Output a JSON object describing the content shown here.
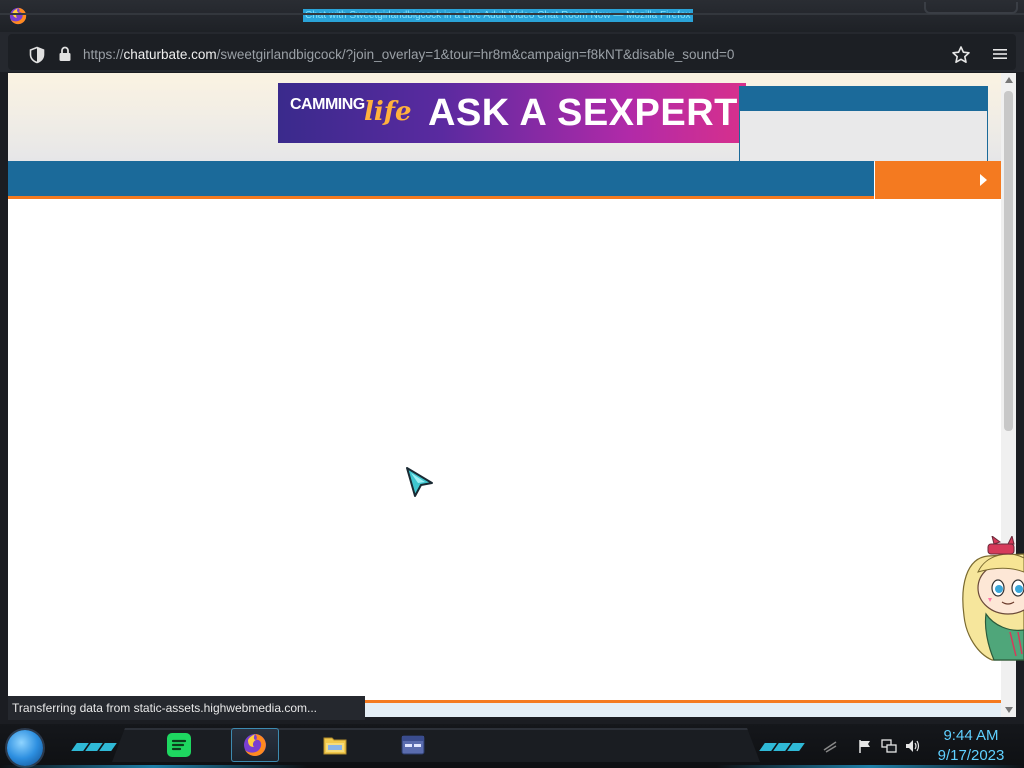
{
  "window": {
    "title": "Chat with Sweetgirlandbigcock in a Live Adult Video Chat Room Now — Mozilla Firefox"
  },
  "navbar": {
    "url_prefix": "https://",
    "url_domain": "chaturbate.com",
    "url_path": "/sweetgirlandbigcock/?join_overlay=1&tour=hr8m&campaign=f8kNT&disable_sound=0",
    "icons": [
      "shield-icon",
      "lock-icon",
      "bookmark-star-icon",
      "menu-icon"
    ]
  },
  "page": {
    "ad": {
      "brand_part1": "CAMMING",
      "brand_part2": "life",
      "headline": "ASK A SEXPERT"
    }
  },
  "status": {
    "text": "Transferring data from static-assets.highwebmedia.com..."
  },
  "taskbar": {
    "apps": [
      {
        "name": "Spotify",
        "active": false
      },
      {
        "name": "Firefox",
        "active": true
      },
      {
        "name": "File Explorer",
        "active": false
      },
      {
        "name": "Window",
        "active": false
      }
    ],
    "clock": {
      "time": "9:44 AM",
      "date": "9/17/2023"
    }
  },
  "colors": {
    "accent_blue": "#1b6a9a",
    "accent_orange": "#f47a20",
    "clock_cyan": "#5fd0ff"
  }
}
